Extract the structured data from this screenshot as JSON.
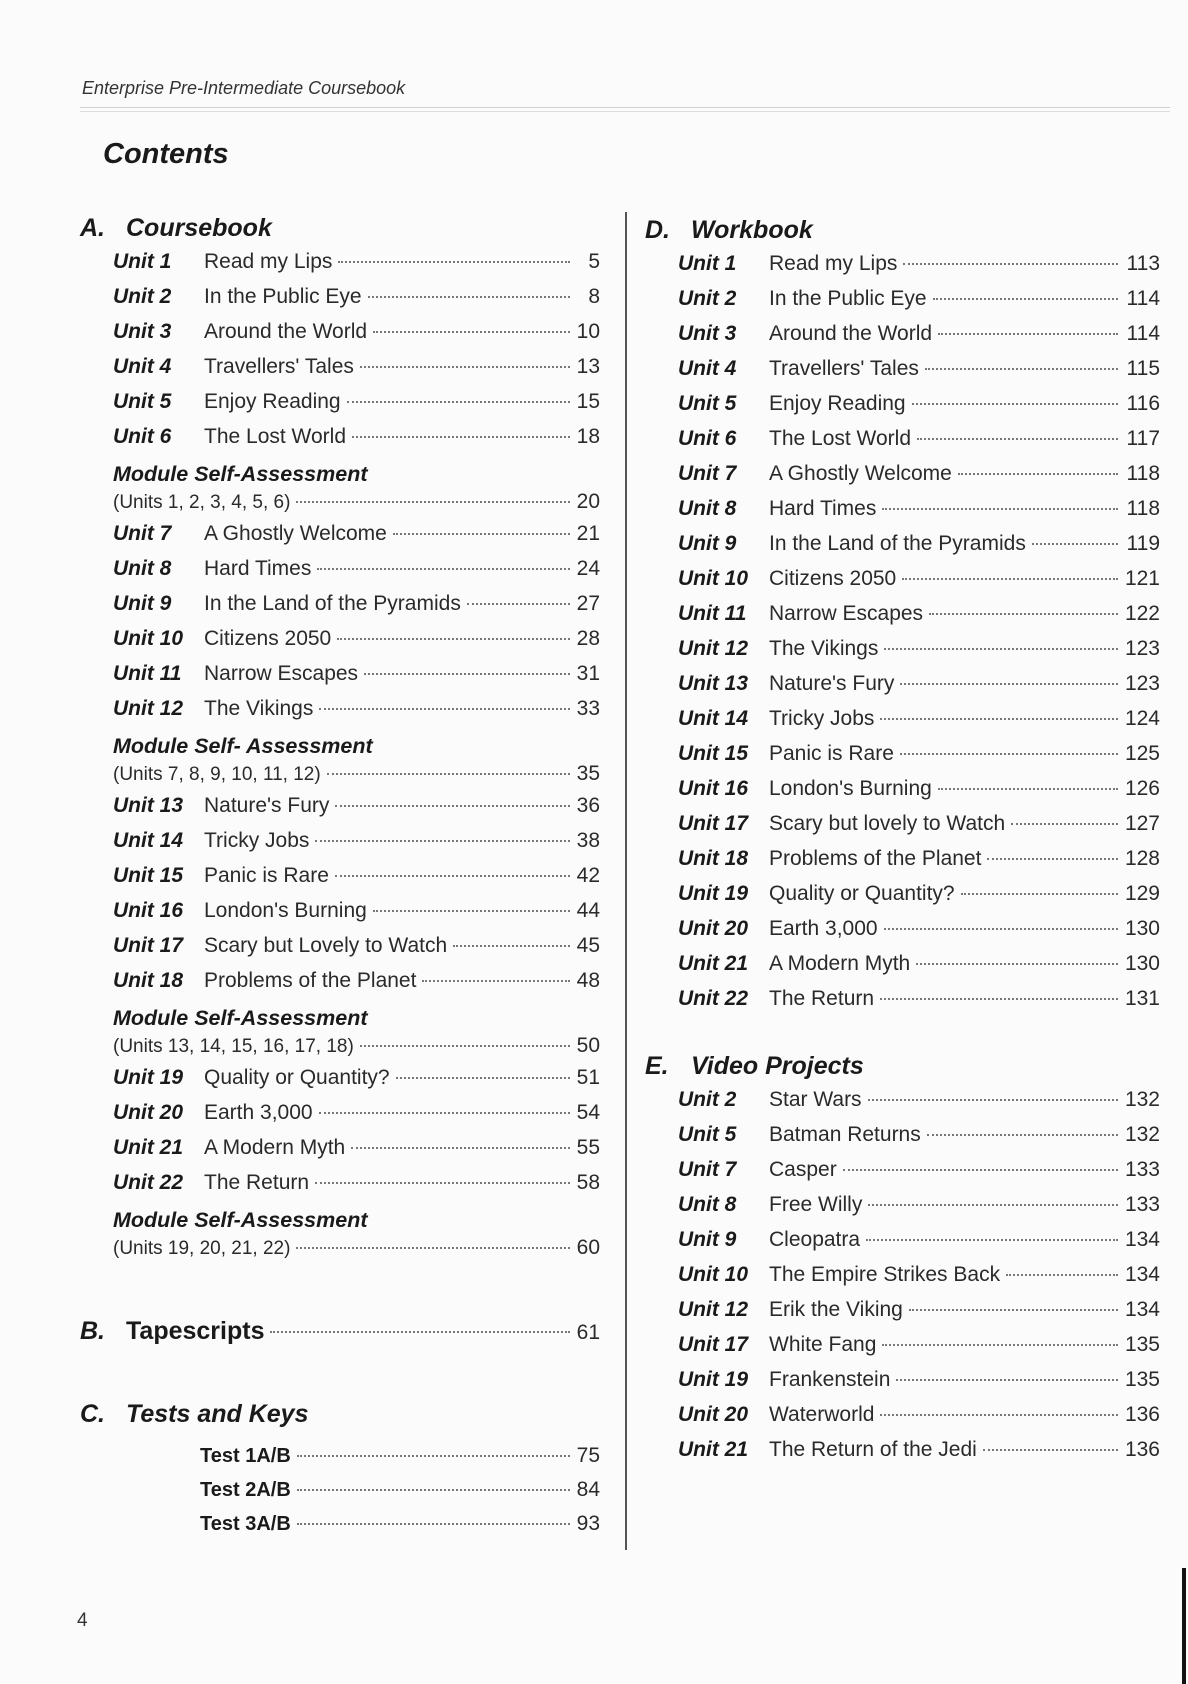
{
  "header": {
    "running_head": "Enterprise Pre-Intermediate Coursebook",
    "page_title": "Contents",
    "page_number": "4"
  },
  "sections": {
    "A": {
      "letter": "A.",
      "name": "Coursebook",
      "items": [
        {
          "unit": "Unit 1",
          "title": "Read my Lips",
          "page": "5"
        },
        {
          "unit": "Unit 2",
          "title": "In the Public Eye",
          "page": "8"
        },
        {
          "unit": "Unit 3",
          "title": "Around the World",
          "page": "10"
        },
        {
          "unit": "Unit 4",
          "title": "Travellers' Tales",
          "page": "13"
        },
        {
          "unit": "Unit 5",
          "title": "Enjoy Reading",
          "page": "15"
        },
        {
          "unit": "Unit 6",
          "title": "The Lost World",
          "page": "18"
        },
        {
          "module": "Module Self-Assessment",
          "title": "(Units 1, 2, 3, 4, 5, 6)",
          "page": "20"
        },
        {
          "unit": "Unit 7",
          "title": "A Ghostly Welcome",
          "page": "21"
        },
        {
          "unit": "Unit 8",
          "title": "Hard Times",
          "page": "24"
        },
        {
          "unit": "Unit 9",
          "title": "In the Land of the Pyramids",
          "page": "27"
        },
        {
          "unit": "Unit 10",
          "title": "Citizens 2050",
          "page": "28"
        },
        {
          "unit": "Unit 11",
          "title": "Narrow Escapes",
          "page": "31"
        },
        {
          "unit": "Unit 12",
          "title": "The Vikings",
          "page": "33"
        },
        {
          "module": "Module Self- Assessment",
          "title": "(Units 7, 8, 9, 10, 11, 12)",
          "page": "35"
        },
        {
          "unit": "Unit 13",
          "title": "Nature's Fury",
          "page": "36"
        },
        {
          "unit": "Unit 14",
          "title": "Tricky Jobs",
          "page": "38"
        },
        {
          "unit": "Unit 15",
          "title": "Panic is Rare",
          "page": "42"
        },
        {
          "unit": "Unit 16",
          "title": "London's Burning",
          "page": "44"
        },
        {
          "unit": "Unit 17",
          "title": "Scary but Lovely to Watch",
          "page": "45"
        },
        {
          "unit": "Unit 18",
          "title": "Problems of the Planet",
          "page": "48"
        },
        {
          "module": "Module Self-Assessment",
          "title": "(Units 13, 14, 15, 16, 17, 18)",
          "page": "50"
        },
        {
          "unit": "Unit 19",
          "title": "Quality or Quantity?",
          "page": "51"
        },
        {
          "unit": "Unit 20",
          "title": "Earth 3,000",
          "page": "54"
        },
        {
          "unit": "Unit 21",
          "title": "A Modern Myth",
          "page": "55"
        },
        {
          "unit": "Unit 22",
          "title": "The Return",
          "page": "58"
        },
        {
          "module": "Module Self-Assessment",
          "title": "(Units 19, 20, 21, 22)",
          "page": "60"
        }
      ]
    },
    "B": {
      "letter": "B.",
      "name": "Tapescripts",
      "page": "61"
    },
    "C": {
      "letter": "C.",
      "name": "Tests and Keys",
      "items": [
        {
          "title": "Test 1A/B",
          "page": "75"
        },
        {
          "title": "Test 2A/B",
          "page": "84"
        },
        {
          "title": "Test 3A/B",
          "page": "93"
        }
      ]
    },
    "D": {
      "letter": "D.",
      "name": "Workbook",
      "items": [
        {
          "unit": "Unit 1",
          "title": "Read my Lips",
          "page": "113"
        },
        {
          "unit": "Unit 2",
          "title": "In the Public Eye",
          "page": "114"
        },
        {
          "unit": "Unit 3",
          "title": "Around the World",
          "page": "114"
        },
        {
          "unit": "Unit 4",
          "title": "Travellers' Tales",
          "page": "115"
        },
        {
          "unit": "Unit 5",
          "title": "Enjoy Reading",
          "page": "116"
        },
        {
          "unit": "Unit 6",
          "title": "The Lost World",
          "page": "117"
        },
        {
          "unit": "Unit 7",
          "title": "A Ghostly Welcome",
          "page": "118"
        },
        {
          "unit": "Unit 8",
          "title": "Hard Times",
          "page": "118"
        },
        {
          "unit": "Unit 9",
          "title": "In the Land of the Pyramids",
          "page": "119"
        },
        {
          "unit": "Unit 10",
          "title": "Citizens 2050",
          "page": "121"
        },
        {
          "unit": "Unit 11",
          "title": "Narrow Escapes",
          "page": "122"
        },
        {
          "unit": "Unit 12",
          "title": "The Vikings",
          "page": "123"
        },
        {
          "unit": "Unit 13",
          "title": "Nature's Fury",
          "page": "123"
        },
        {
          "unit": "Unit 14",
          "title": "Tricky Jobs",
          "page": "124"
        },
        {
          "unit": "Unit 15",
          "title": "Panic is Rare",
          "page": "125"
        },
        {
          "unit": "Unit 16",
          "title": "London's Burning",
          "page": "126"
        },
        {
          "unit": "Unit 17",
          "title": "Scary but lovely to Watch",
          "page": "127"
        },
        {
          "unit": "Unit 18",
          "title": "Problems of the Planet",
          "page": "128"
        },
        {
          "unit": "Unit 19",
          "title": "Quality or Quantity?",
          "page": "129"
        },
        {
          "unit": "Unit 20",
          "title": "Earth 3,000",
          "page": "130"
        },
        {
          "unit": "Unit 21",
          "title": "A Modern Myth",
          "page": "130"
        },
        {
          "unit": "Unit 22",
          "title": "The Return",
          "page": "131"
        }
      ]
    },
    "E": {
      "letter": "E.",
      "name": "Video Projects",
      "items": [
        {
          "unit": "Unit 2",
          "title": "Star Wars",
          "page": "132"
        },
        {
          "unit": "Unit 5",
          "title": "Batman Returns",
          "page": "132"
        },
        {
          "unit": "Unit 7",
          "title": "Casper",
          "page": "133"
        },
        {
          "unit": "Unit 8",
          "title": "Free Willy",
          "page": "133"
        },
        {
          "unit": "Unit 9",
          "title": "Cleopatra",
          "page": "134"
        },
        {
          "unit": "Unit 10",
          "title": "The Empire Strikes Back",
          "page": "134"
        },
        {
          "unit": "Unit 12",
          "title": "Erik the Viking",
          "page": "134"
        },
        {
          "unit": "Unit 17",
          "title": "White Fang",
          "page": "135"
        },
        {
          "unit": "Unit 19",
          "title": "Frankenstein",
          "page": "135"
        },
        {
          "unit": "Unit 20",
          "title": "Waterworld",
          "page": "136"
        },
        {
          "unit": "Unit 21",
          "title": "The Return of the Jedi",
          "page": "136"
        }
      ]
    }
  }
}
